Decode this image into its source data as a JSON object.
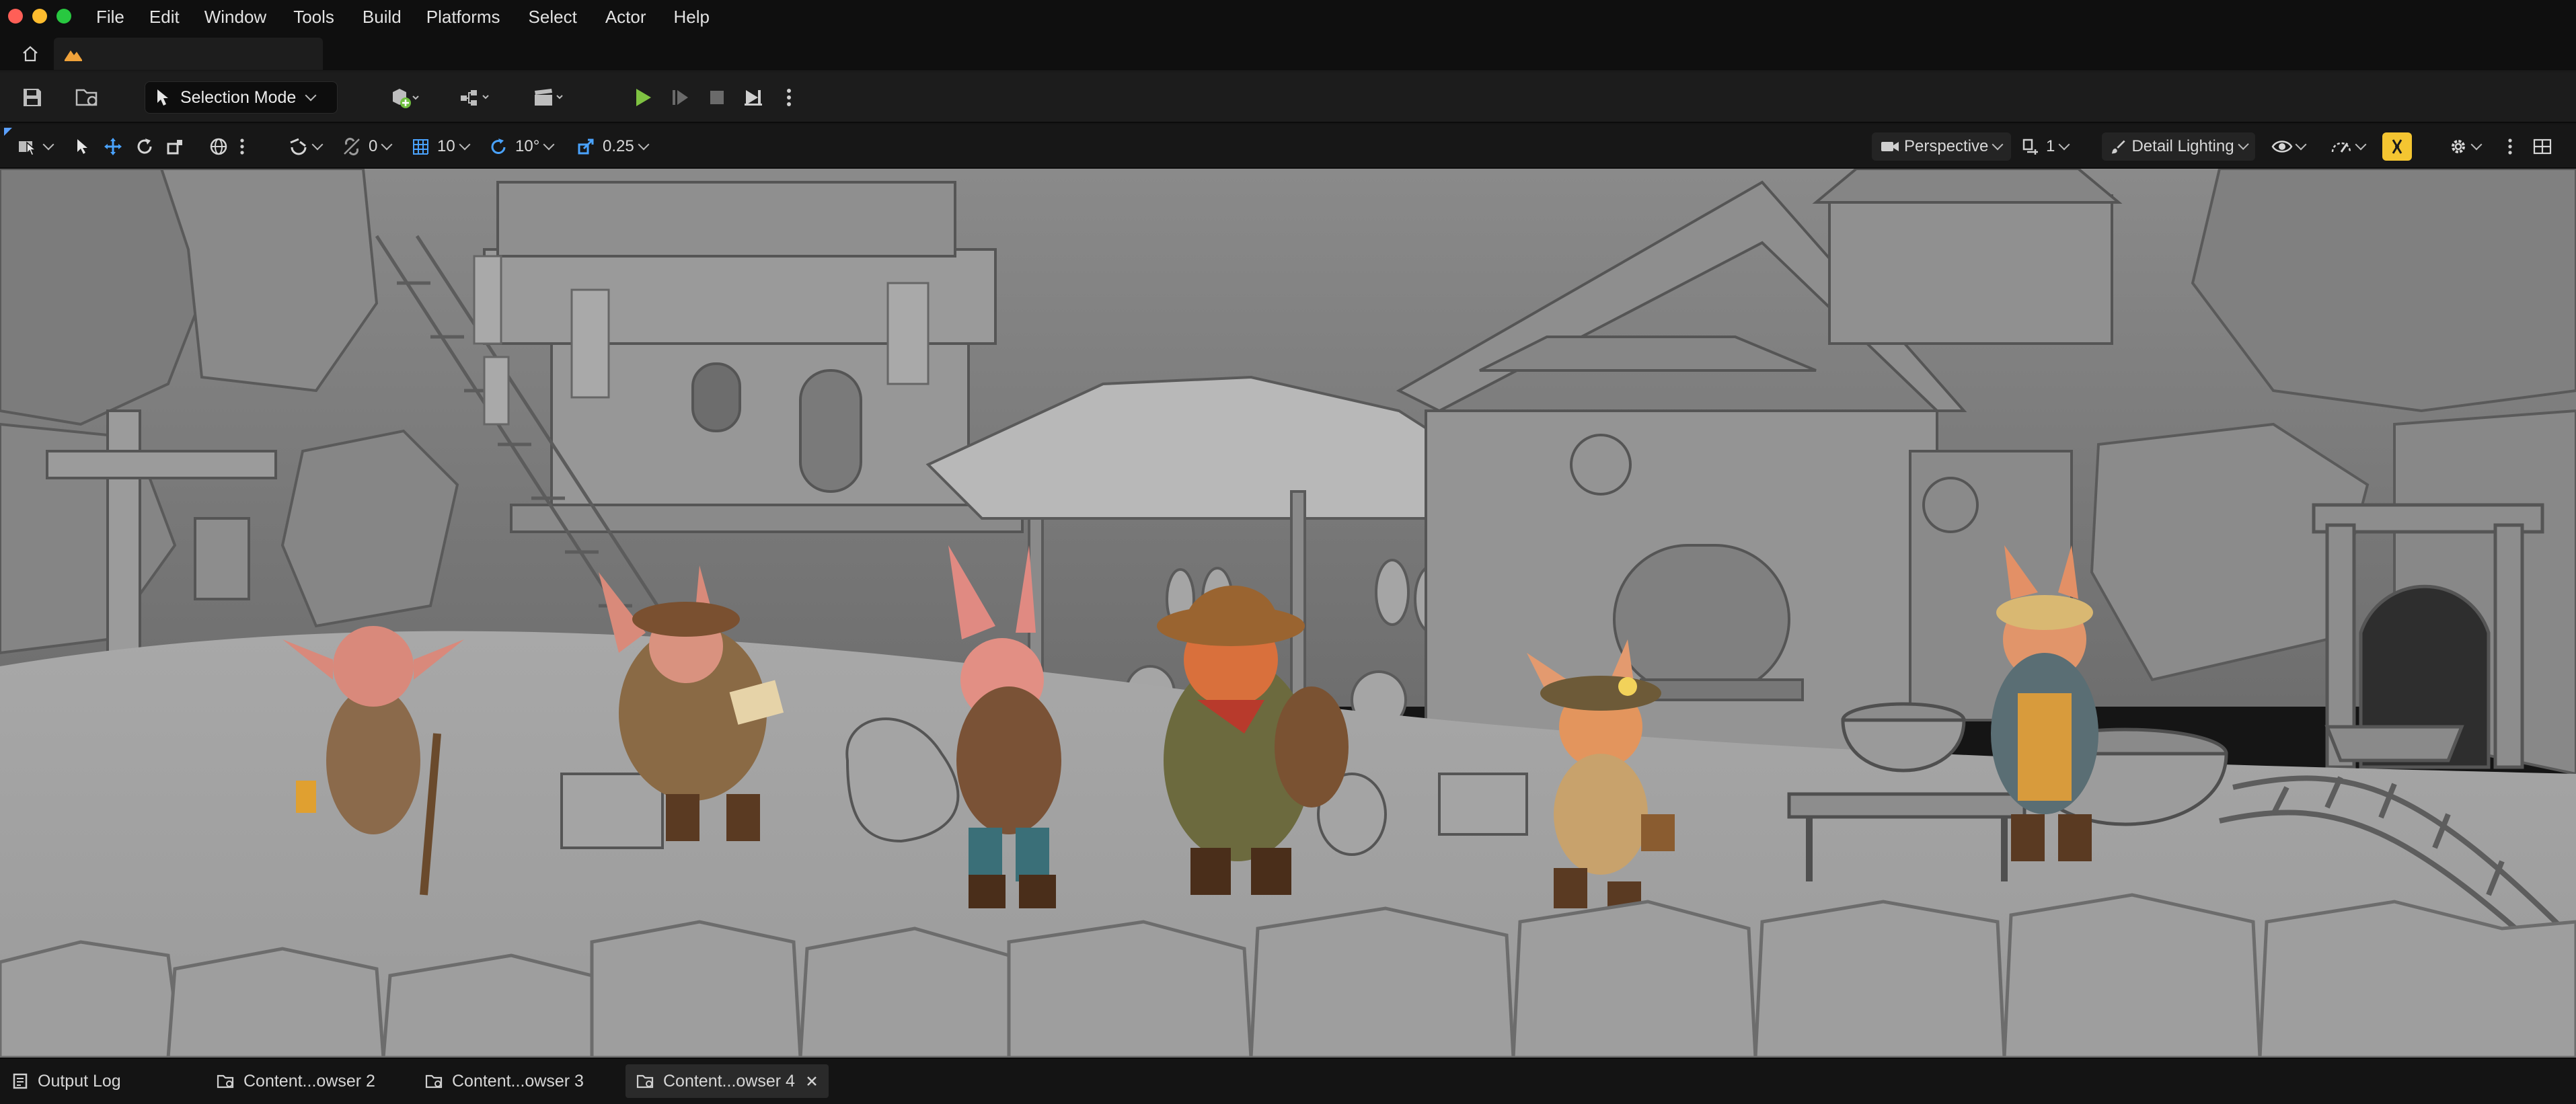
{
  "menu": {
    "items": [
      "File",
      "Edit",
      "Window",
      "Tools",
      "Build",
      "Platforms",
      "Select",
      "Actor",
      "Help"
    ]
  },
  "window_controls": {
    "close_color": "#ff5f57",
    "minimize_color": "#febc2e",
    "maximize_color": "#28c840"
  },
  "tabs": {
    "home_icon": "home-icon",
    "level_icon": "level-icon"
  },
  "toolbar": {
    "mode_label": "Selection Mode",
    "play_color": "#7fc242"
  },
  "viewport_toolbar": {
    "grid_snap_value": "0",
    "location_snap_value": "10",
    "rotation_snap_value": "10°",
    "scale_snap_value": "0.25",
    "view_mode_label": "Perspective",
    "camera_speed_value": "1",
    "lighting_label": "Detail Lighting",
    "accent_color": "#f4c531"
  },
  "bottom_tabs": {
    "output_log": "Output Log",
    "content_browser_2": "Content...owser 2",
    "content_browser_3": "Content...owser 3",
    "content_browser_4": "Content...owser 4"
  }
}
